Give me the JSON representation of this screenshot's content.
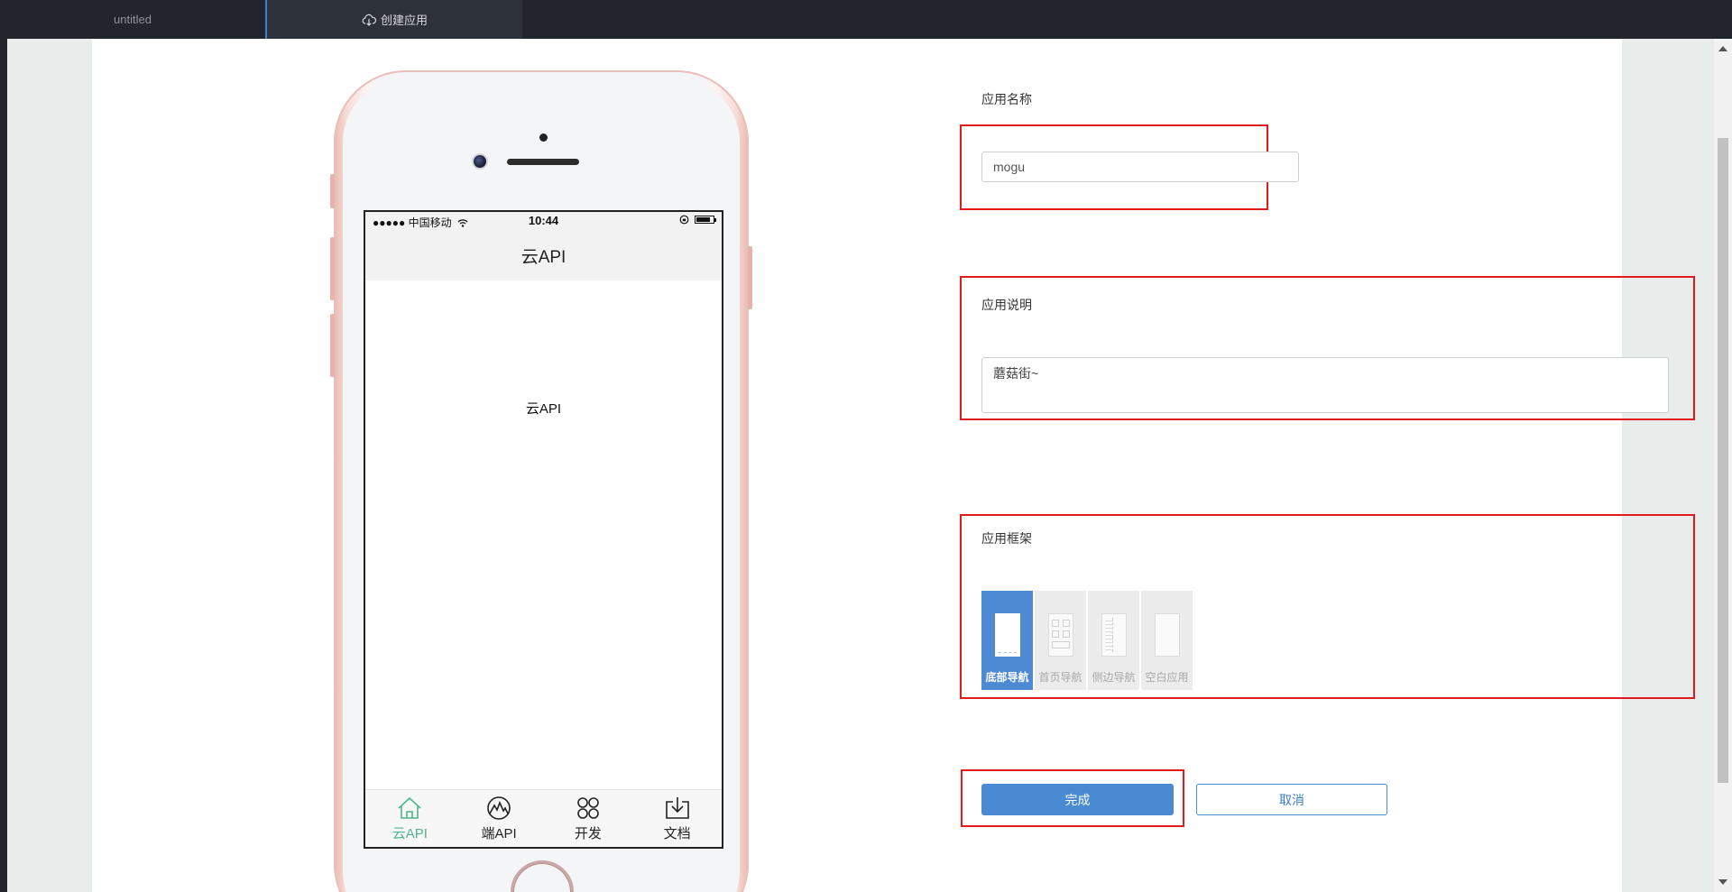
{
  "tabs": [
    {
      "label": "untitled"
    },
    {
      "label": "创建应用",
      "icon": "cloud-download-icon"
    }
  ],
  "phone": {
    "status": {
      "carrier": "●●●●● 中国移动",
      "time": "10:44"
    },
    "nav_title": "云API",
    "content_text": "云API",
    "tabbar": [
      {
        "label": "云API",
        "icon": "home-icon",
        "active": true
      },
      {
        "label": "端API",
        "icon": "mountain-icon",
        "active": false
      },
      {
        "label": "开发",
        "icon": "grid-circles-icon",
        "active": false
      },
      {
        "label": "文档",
        "icon": "download-tray-icon",
        "active": false
      }
    ]
  },
  "form": {
    "name_label": "应用名称",
    "name_value": "mogu",
    "desc_label": "应用说明",
    "desc_value": "蘑菇街~",
    "frame_label": "应用框架",
    "frames": [
      {
        "label": "底部导航",
        "selected": true
      },
      {
        "label": "首页导航",
        "selected": false
      },
      {
        "label": "侧边导航",
        "selected": false
      },
      {
        "label": "空白应用",
        "selected": false
      }
    ],
    "submit_label": "完成",
    "cancel_label": "取消"
  },
  "colors": {
    "accent": "#4a8ad2",
    "highlight_box": "#e11b1b",
    "tab_active": "#4fb58b"
  }
}
